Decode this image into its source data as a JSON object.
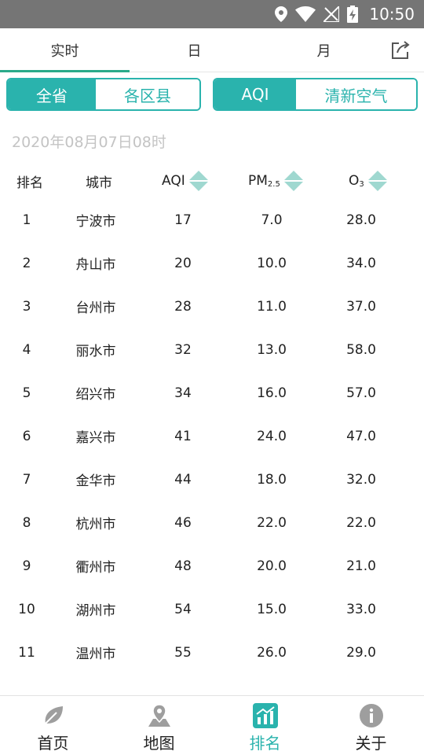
{
  "status_bar": {
    "time": "10:50"
  },
  "tabs": [
    {
      "label": "实时"
    },
    {
      "label": "日"
    },
    {
      "label": "月"
    }
  ],
  "segment_region": {
    "options": [
      "全省",
      "各区县"
    ],
    "selected": "全省"
  },
  "segment_metric": {
    "options": [
      "AQI",
      "清新空气"
    ],
    "selected": "AQI"
  },
  "timestamp": "2020年08月07日08时",
  "table": {
    "headers": {
      "rank": "排名",
      "city": "城市",
      "aqi": "AQI",
      "pm_main": "PM",
      "pm_sub": "2.5",
      "o3_main": "O",
      "o3_sub": "3"
    },
    "rows": [
      {
        "rank": "1",
        "city": "宁波市",
        "aqi": "17",
        "pm25": "7.0",
        "o3": "28.0"
      },
      {
        "rank": "2",
        "city": "舟山市",
        "aqi": "20",
        "pm25": "10.0",
        "o3": "34.0"
      },
      {
        "rank": "3",
        "city": "台州市",
        "aqi": "28",
        "pm25": "11.0",
        "o3": "37.0"
      },
      {
        "rank": "4",
        "city": "丽水市",
        "aqi": "32",
        "pm25": "13.0",
        "o3": "58.0"
      },
      {
        "rank": "5",
        "city": "绍兴市",
        "aqi": "34",
        "pm25": "16.0",
        "o3": "57.0"
      },
      {
        "rank": "6",
        "city": "嘉兴市",
        "aqi": "41",
        "pm25": "24.0",
        "o3": "47.0"
      },
      {
        "rank": "7",
        "city": "金华市",
        "aqi": "44",
        "pm25": "18.0",
        "o3": "32.0"
      },
      {
        "rank": "8",
        "city": "杭州市",
        "aqi": "46",
        "pm25": "22.0",
        "o3": "22.0"
      },
      {
        "rank": "9",
        "city": "衢州市",
        "aqi": "48",
        "pm25": "20.0",
        "o3": "21.0"
      },
      {
        "rank": "10",
        "city": "湖州市",
        "aqi": "54",
        "pm25": "15.0",
        "o3": "33.0"
      },
      {
        "rank": "11",
        "city": "温州市",
        "aqi": "55",
        "pm25": "26.0",
        "o3": "29.0"
      }
    ]
  },
  "bottom_nav": [
    {
      "label": "首页",
      "icon": "leaf-icon"
    },
    {
      "label": "地图",
      "icon": "map-pin-icon"
    },
    {
      "label": "排名",
      "icon": "ranking-chart-icon",
      "active": true
    },
    {
      "label": "关于",
      "icon": "info-icon"
    }
  ],
  "colors": {
    "accent": "#2ab3ad",
    "tab_indicator": "#2aaa8a",
    "status_bar": "#757575"
  }
}
